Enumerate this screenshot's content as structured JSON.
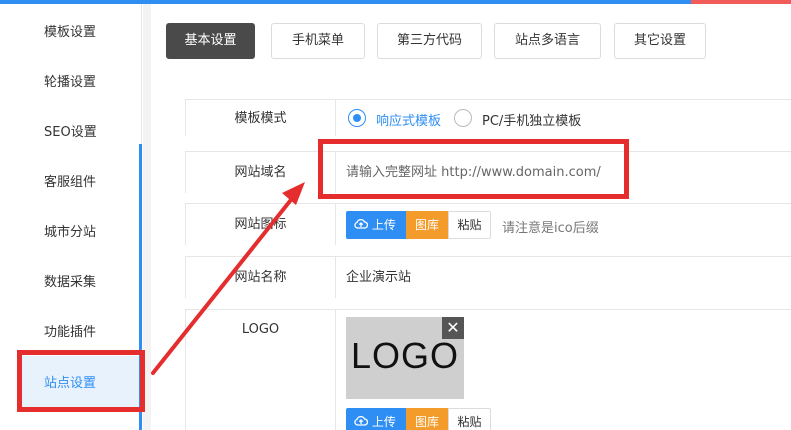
{
  "sidebar": {
    "items": [
      {
        "label": "模板设置"
      },
      {
        "label": "轮播设置"
      },
      {
        "label": "SEO设置"
      },
      {
        "label": "客服组件"
      },
      {
        "label": "城市分站"
      },
      {
        "label": "数据采集"
      },
      {
        "label": "功能插件"
      },
      {
        "label": "站点设置"
      }
    ]
  },
  "tabs": [
    {
      "label": "基本设置"
    },
    {
      "label": "手机菜单"
    },
    {
      "label": "第三方代码"
    },
    {
      "label": "站点多语言"
    },
    {
      "label": "其它设置"
    }
  ],
  "form": {
    "template_mode": {
      "label": "模板模式",
      "options": [
        "响应式模板",
        "PC/手机独立模板"
      ],
      "selected": "响应式模板"
    },
    "domain": {
      "label": "网站域名",
      "placeholder": "请输入完整网址 http://www.domain.com/"
    },
    "icon": {
      "label": "网站图标",
      "upload": "上传",
      "library": "图库",
      "paste": "粘贴",
      "hint": "请注意是ico后缀"
    },
    "site_name": {
      "label": "网站名称",
      "value": "企业演示站"
    },
    "logo": {
      "label": "LOGO",
      "preview_text": "LOGO",
      "close": "✕",
      "upload": "上传",
      "library": "图库",
      "paste": "粘贴"
    }
  },
  "colors": {
    "primary": "#2f8ef4",
    "library": "#f39c2b",
    "highlight": "#e52d2d",
    "active_tab": "#4a4a4a"
  }
}
